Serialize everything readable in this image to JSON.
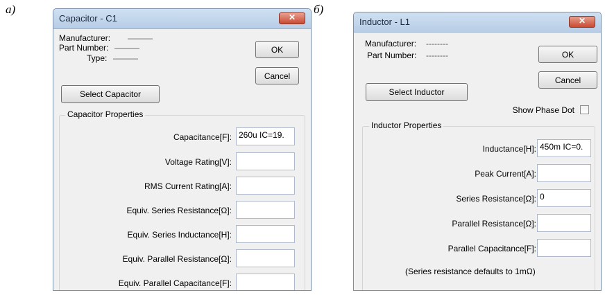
{
  "labels": {
    "left": "а)",
    "right": "б)"
  },
  "capacitor": {
    "title": "Capacitor - C1",
    "close": "✕",
    "manufacturer_label": "Manufacturer:",
    "manufacturer_value": "———",
    "part_number_label": "Part Number:",
    "part_number_value": "———",
    "type_label": "Type:",
    "type_value": "———",
    "ok": "OK",
    "cancel": "Cancel",
    "select_button": "Select Capacitor",
    "group_title": "Capacitor Properties",
    "props": [
      {
        "label": "Capacitance[F]:",
        "value": "260u IC=19."
      },
      {
        "label": "Voltage Rating[V]:",
        "value": ""
      },
      {
        "label": "RMS Current Rating[A]:",
        "value": ""
      },
      {
        "label": "Equiv. Series Resistance[Ω]:",
        "value": ""
      },
      {
        "label": "Equiv. Series Inductance[H]:",
        "value": ""
      },
      {
        "label": "Equiv. Parallel Resistance[Ω]:",
        "value": ""
      },
      {
        "label": "Equiv. Parallel Capacitance[F]:",
        "value": ""
      }
    ]
  },
  "inductor": {
    "title": "Inductor - L1",
    "close": "✕",
    "manufacturer_label": "Manufacturer:",
    "manufacturer_value": "--------",
    "part_number_label": "Part Number:",
    "part_number_value": "--------",
    "ok": "OK",
    "cancel": "Cancel",
    "select_button": "Select Inductor",
    "show_phase_dot": "Show Phase Dot",
    "group_title": "Inductor Properties",
    "props": [
      {
        "label": "Inductance[H]:",
        "value": "450m IC=0."
      },
      {
        "label": "Peak Current[A]:",
        "value": ""
      },
      {
        "label": "Series Resistance[Ω]:",
        "value": "0"
      },
      {
        "label": "Parallel Resistance[Ω]:",
        "value": ""
      },
      {
        "label": "Parallel Capacitance[F]:",
        "value": ""
      }
    ],
    "note": "(Series resistance defaults to 1mΩ)"
  }
}
